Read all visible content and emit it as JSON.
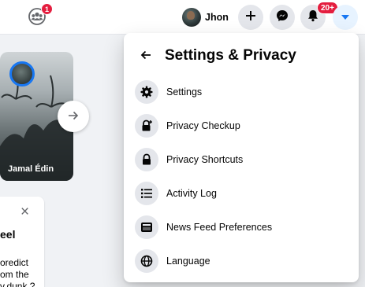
{
  "topbar": {
    "groups_badge": "1",
    "profile_name": "Jhon",
    "notifications_badge": "20+",
    "icons": {
      "groups": "groups-icon",
      "create": "plus-icon",
      "messenger": "messenger-icon",
      "notifications": "bell-icon",
      "account": "caret-down-icon"
    },
    "colors": {
      "badge": "#e41e3f",
      "accent": "#1877f2"
    }
  },
  "stories": {
    "card_name": "Jamal Édin",
    "next_icon": "arrow-right-icon"
  },
  "info_card": {
    "title": "eel",
    "body_lines": [
      "oredict",
      "om the",
      "v.dunk ?"
    ]
  },
  "settings_menu": {
    "title": "Settings & Privacy",
    "back_icon": "arrow-left-icon",
    "items": [
      {
        "label": "Settings",
        "icon": "gear-icon"
      },
      {
        "label": "Privacy Checkup",
        "icon": "lock-plus-icon"
      },
      {
        "label": "Privacy Shortcuts",
        "icon": "lock-icon"
      },
      {
        "label": "Activity Log",
        "icon": "list-icon"
      },
      {
        "label": "News Feed Preferences",
        "icon": "feed-icon"
      },
      {
        "label": "Language",
        "icon": "globe-icon"
      }
    ]
  }
}
